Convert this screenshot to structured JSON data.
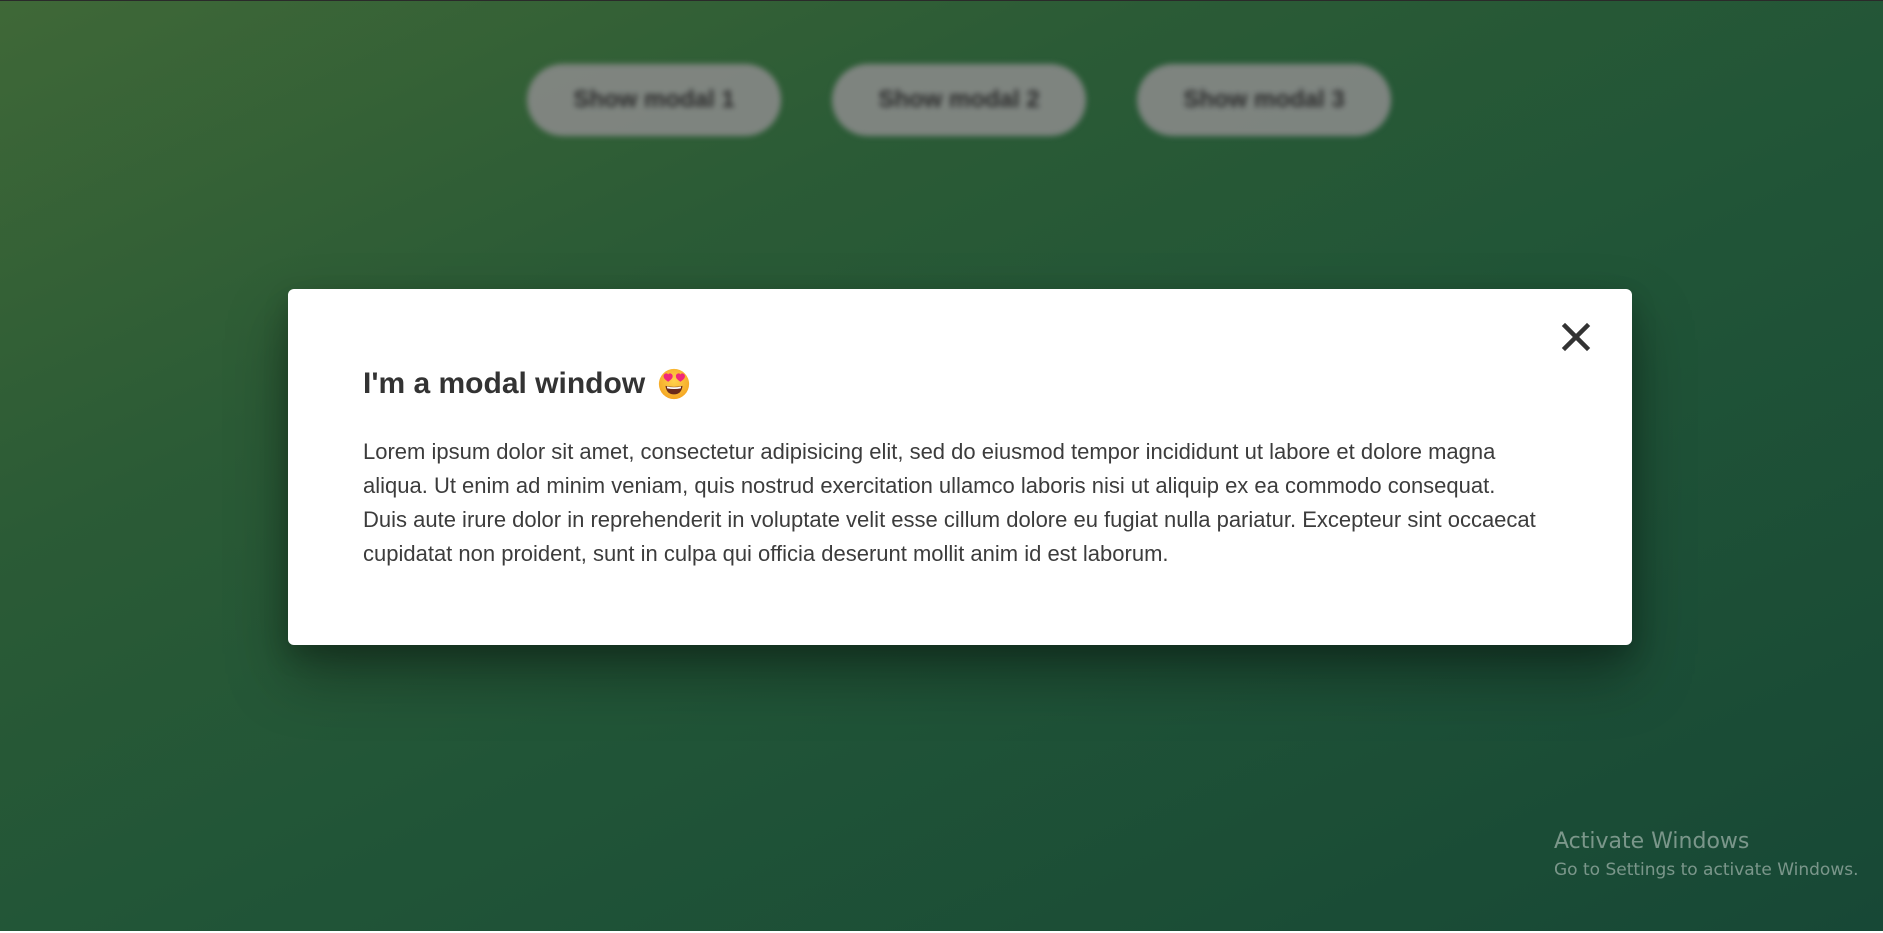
{
  "background_buttons": [
    {
      "label": "Show modal 1"
    },
    {
      "label": "Show modal 2"
    },
    {
      "label": "Show modal 3"
    }
  ],
  "modal": {
    "title": "I'm a modal window",
    "title_icon": "smiling-face-with-heart-eyes-icon",
    "close_icon": "close-icon",
    "body": "Lorem ipsum dolor sit amet, consectetur adipisicing elit, sed do eiusmod tempor incididunt ut labore et dolore magna aliqua. Ut enim ad minim veniam, quis nostrud exercitation ullamco laboris nisi ut aliquip ex ea commodo consequat. Duis aute irure dolor in reprehenderit in voluptate velit esse cillum dolore eu fugiat nulla pariatur. Excepteur sint occaecat cupidatat non proident, sunt in culpa qui officia deserunt mollit anim id est laborum."
  },
  "watermark": {
    "title": "Activate Windows",
    "subtitle": "Go to Settings to activate Windows."
  },
  "colors": {
    "background_start": "#3f6837",
    "background_end": "#174836",
    "modal_background": "#ffffff",
    "button_background": "#8a8a8a",
    "text": "#333333"
  }
}
